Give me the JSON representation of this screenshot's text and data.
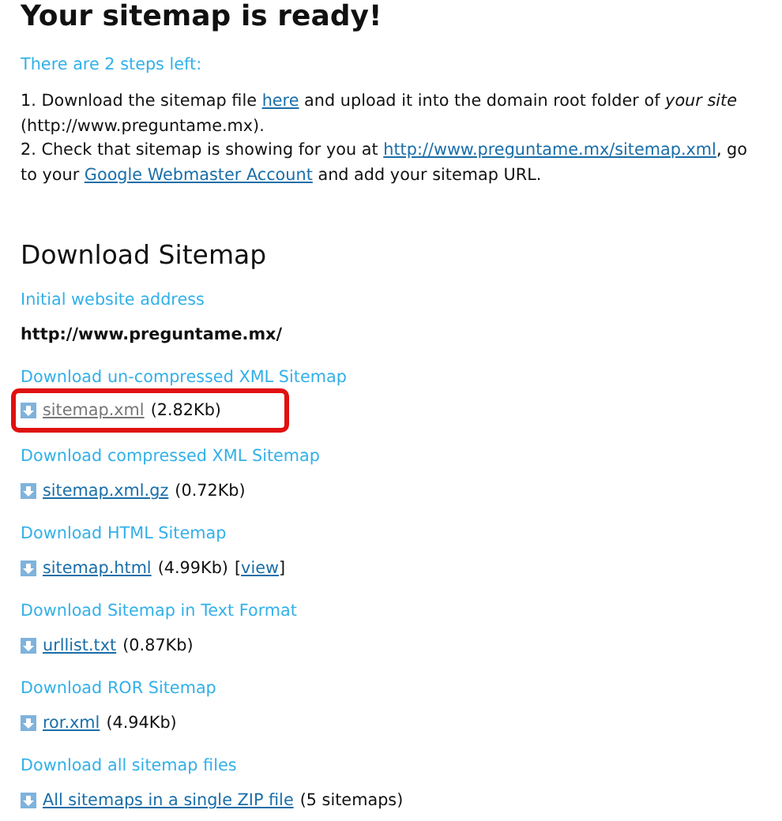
{
  "title": "Your sitemap is ready!",
  "steps_heading": "There are 2 steps left:",
  "steps": [
    {
      "parts": [
        {
          "kind": "text",
          "text": "1. Download the sitemap file "
        },
        {
          "kind": "link",
          "text": "here"
        },
        {
          "kind": "text",
          "text": " and upload it into the domain root folder of "
        },
        {
          "kind": "italic",
          "text": "your site"
        },
        {
          "kind": "text",
          "text": " (http://www.preguntame.mx)."
        }
      ]
    },
    {
      "parts": [
        {
          "kind": "text",
          "text": "2. Check that sitemap is showing for you at "
        },
        {
          "kind": "link",
          "text": "http://www.preguntame.mx/sitemap.xml"
        },
        {
          "kind": "text",
          "text": ", go to your "
        },
        {
          "kind": "link",
          "text": "Google Webmaster Account"
        },
        {
          "kind": "text",
          "text": " and add your sitemap URL."
        }
      ]
    }
  ],
  "download_heading": "Download Sitemap",
  "sections": [
    {
      "label": "Initial website address",
      "kind": "address",
      "value": "http://www.preguntame.mx/"
    },
    {
      "label": "Download un-compressed XML Sitemap",
      "kind": "file",
      "file": "sitemap.xml",
      "size": "(2.82Kb)",
      "visited": true,
      "highlighted": true
    },
    {
      "label": "Download compressed XML Sitemap",
      "kind": "file",
      "file": "sitemap.xml.gz",
      "size": "(0.72Kb)",
      "visited": false,
      "highlighted": false
    },
    {
      "label": "Download HTML Sitemap",
      "kind": "file",
      "file": "sitemap.html",
      "size": "(4.99Kb)",
      "visited": false,
      "highlighted": false,
      "extra": {
        "open": "[",
        "link": "view",
        "close": "]"
      }
    },
    {
      "label": "Download Sitemap in Text Format",
      "kind": "file",
      "file": "urllist.txt",
      "size": "(0.87Kb)",
      "visited": false,
      "highlighted": false
    },
    {
      "label": "Download ROR Sitemap",
      "kind": "file",
      "file": "ror.xml",
      "size": "(4.94Kb)",
      "visited": false,
      "highlighted": false
    },
    {
      "label": "Download all sitemap files",
      "kind": "file",
      "file": "All sitemaps in a single ZIP file",
      "size": "(5 sitemaps)",
      "visited": false,
      "highlighted": false
    }
  ]
}
